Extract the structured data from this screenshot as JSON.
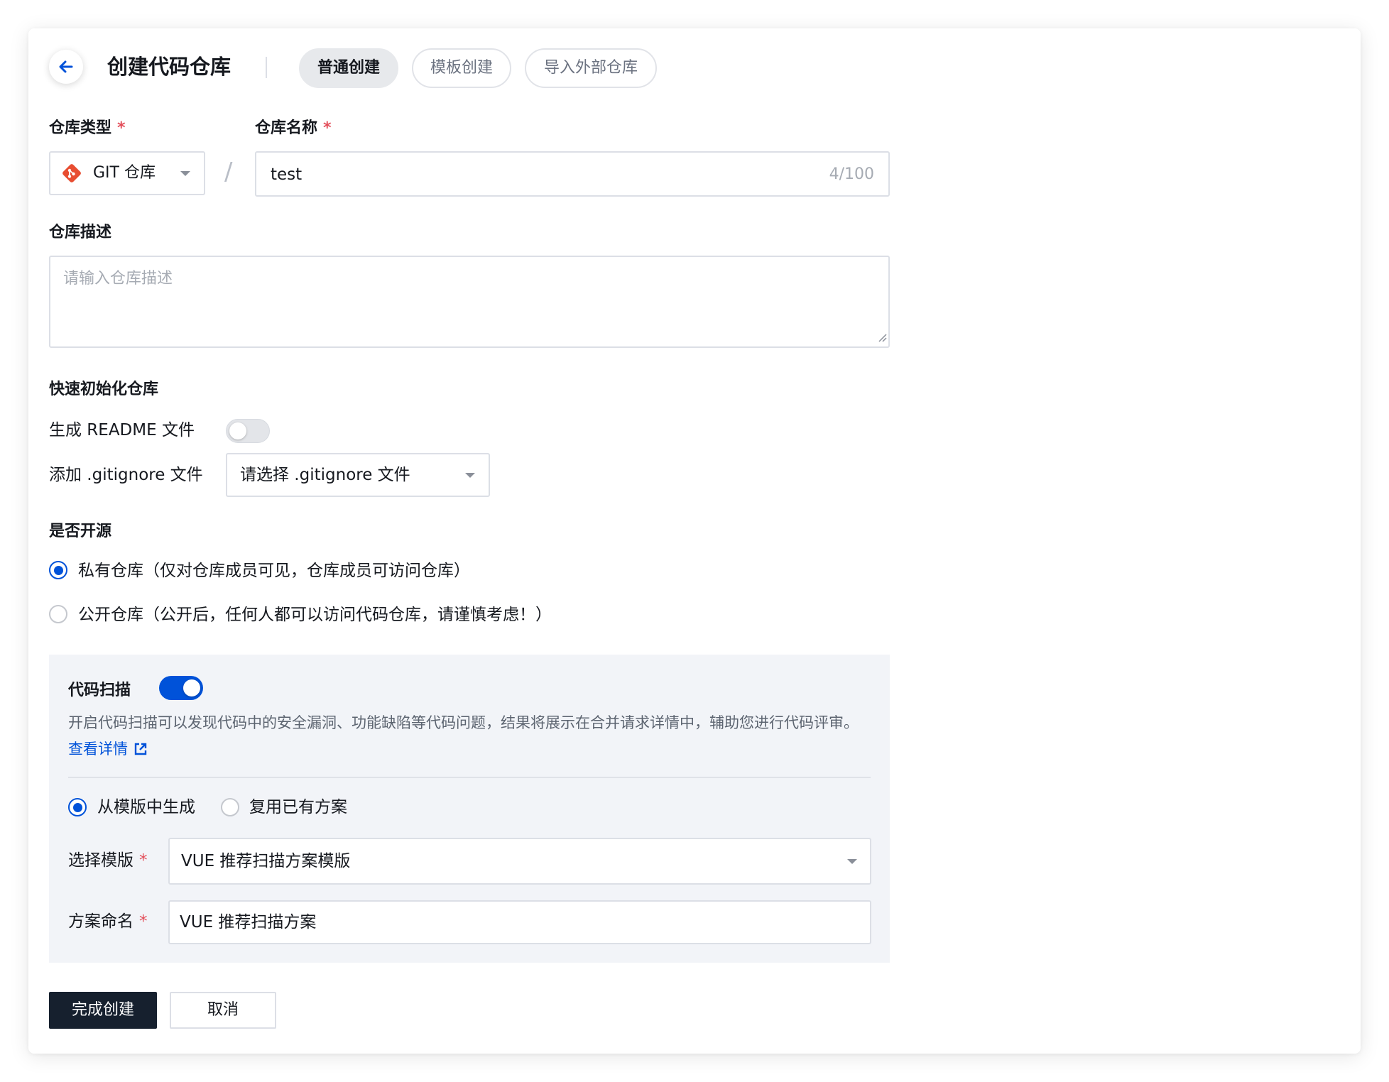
{
  "header": {
    "title": "创建代码仓库",
    "tabs": [
      {
        "label": "普通创建",
        "active": true
      },
      {
        "label": "模板创建",
        "active": false
      },
      {
        "label": "导入外部仓库",
        "active": false
      }
    ]
  },
  "repo_type": {
    "label": "仓库类型",
    "required_mark": "*",
    "selected": "GIT 仓库",
    "icon": "git-icon"
  },
  "path_separator": "/",
  "repo_name": {
    "label": "仓库名称",
    "required_mark": "*",
    "value": "test",
    "counter": "4/100"
  },
  "repo_desc": {
    "label": "仓库描述",
    "placeholder": "请输入仓库描述",
    "value": ""
  },
  "quick_init": {
    "heading": "快速初始化仓库",
    "readme_label": "生成 README 文件",
    "readme_enabled": false,
    "gitignore_label": "添加 .gitignore 文件",
    "gitignore_selected": "请选择 .gitignore 文件"
  },
  "open_source": {
    "heading": "是否开源",
    "options": [
      {
        "label": "私有仓库（仅对仓库成员可见，仓库成员可访问仓库）",
        "checked": true
      },
      {
        "label": "公开仓库（公开后，任何人都可以访问代码仓库，请谨慎考虑！）",
        "checked": false
      }
    ]
  },
  "code_scan": {
    "heading": "代码扫描",
    "enabled": true,
    "description": "开启代码扫描可以发现代码中的安全漏洞、功能缺陷等代码问题，结果将展示在合并请求详情中，辅助您进行代码评审。",
    "link_text": "查看详情",
    "modes": [
      {
        "label": "从模版中生成",
        "checked": true
      },
      {
        "label": "复用已有方案",
        "checked": false
      }
    ],
    "template_label": "选择模版",
    "template_required_mark": "*",
    "template_selected": "VUE 推荐扫描方案模版",
    "scheme_label": "方案命名",
    "scheme_required_mark": "*",
    "scheme_value": "VUE 推荐扫描方案"
  },
  "actions": {
    "submit": "完成创建",
    "cancel": "取消"
  },
  "colors": {
    "primary": "#0052d9",
    "required": "#e34d59",
    "dark_button": "#16202e",
    "git_brand": "#e84d31",
    "panel_bg": "#f2f4f8"
  }
}
